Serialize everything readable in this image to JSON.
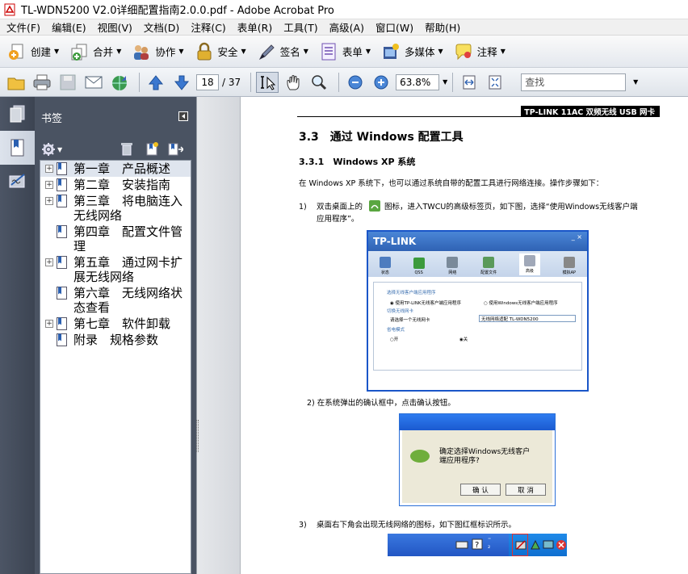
{
  "window": {
    "title": "TL-WDN5200 V2.0详细配置指南2.0.0.pdf - Adobe Acrobat Pro"
  },
  "menu": [
    "文件(F)",
    "编辑(E)",
    "视图(V)",
    "文档(D)",
    "注释(C)",
    "表单(R)",
    "工具(T)",
    "高级(A)",
    "窗口(W)",
    "帮助(H)"
  ],
  "tasks": [
    {
      "label": "创建",
      "icon": "create-pdf-icon"
    },
    {
      "label": "合并",
      "icon": "combine-icon"
    },
    {
      "label": "协作",
      "icon": "collaborate-icon"
    },
    {
      "label": "安全",
      "icon": "lock-icon"
    },
    {
      "label": "签名",
      "icon": "pen-icon"
    },
    {
      "label": "表单",
      "icon": "form-icon"
    },
    {
      "label": "多媒体",
      "icon": "film-icon"
    },
    {
      "label": "注释",
      "icon": "comment-icon"
    }
  ],
  "nav": {
    "page": "18",
    "total": "/ 37",
    "zoom": "63.8%",
    "find_placeholder": "查找"
  },
  "bookmarks": {
    "title": "书签",
    "items": [
      {
        "label": "第一章　产品概述",
        "expandable": true
      },
      {
        "label": "第二章　安装指南",
        "expandable": true
      },
      {
        "label": "第三章　将电脑连入无线网络",
        "expandable": true
      },
      {
        "label": "第四章　配置文件管理",
        "expandable": false
      },
      {
        "label": "第五章　通过网卡扩展无线网络",
        "expandable": true
      },
      {
        "label": "第六章　无线网络状态查看",
        "expandable": false
      },
      {
        "label": "第七章　软件卸载",
        "expandable": true
      },
      {
        "label": "附录　规格参数",
        "expandable": false
      }
    ]
  },
  "doc": {
    "header": "TP-LINK 11AC 双频无线 USB 网卡",
    "h1": "3.3　通过 Windows 配置工具",
    "h2": "3.3.1　Windows XP 系统",
    "intro": "在 Windows XP 系统下，也可以通过系统自带的配置工具进行网络连接。操作步骤如下：",
    "step1_num": "1)",
    "step1_a": "双击桌面上的",
    "step1_b": "图标，进入TWCU的高级标签页，如下图，选择“使用Windows无线客户端",
    "step1_c": "应用程序”。",
    "step2": "2) 在系统弹出的确认框中，点击确认按钮。",
    "step3_num": "3)",
    "step3": "桌面右下角会出现无线网络的图标，如下图红框标识所示。",
    "shot1": {
      "brand": "TP-LINK",
      "tabs": [
        "状态",
        "QSS",
        "网络",
        "配置文件",
        "高级",
        "模拟AP"
      ],
      "l1": "选择无线客户端应用程序",
      "r1a": "◉ 使用TP-LINK无线客户端应用程序",
      "r1b": "○ 使用Windows无线客户端应用程序",
      "l2": "切换无线网卡",
      "l3": "请选择一个无线网卡",
      "sel": "无线网络适配 TL-WDN5200",
      "l4": "省电模式",
      "r2a": "○开",
      "r2b": "◉关"
    },
    "shot2": {
      "msg": "确定选择Windows无线客户端应用程序?",
      "ok": "确 认",
      "cancel": "取 消"
    }
  }
}
